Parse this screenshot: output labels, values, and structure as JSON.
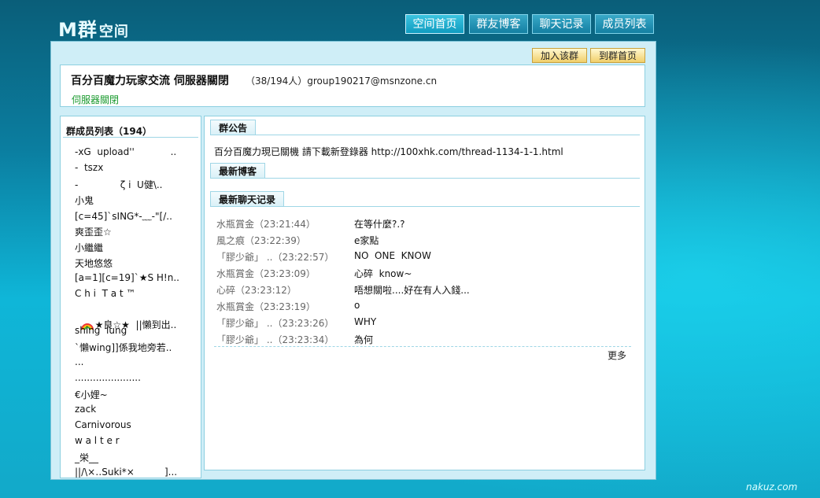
{
  "logo": {
    "main": "M群",
    "sub": "空间"
  },
  "nav": [
    {
      "label": "空间首页"
    },
    {
      "label": "群友博客"
    },
    {
      "label": "聊天记录"
    },
    {
      "label": "成员列表"
    }
  ],
  "actions": {
    "join": "加入该群",
    "home": "到群首页"
  },
  "group": {
    "name": "百分百魔力玩家交流 伺服器關閉",
    "meta": "（38/194人）group190217@msnzone.cn",
    "description": "伺服器關閉"
  },
  "sidebar": {
    "title": "群成员列表（194）",
    "members": [
      "-xG  upload''            ..",
      "-  tszx",
      "-              ζ i  U健\\..",
      "小鬼",
      "[c=45]`sING*-﹏-\"[/..",
      "爽歪歪☆",
      "小繼繼",
      "天地悠悠",
      "[a=1][c=19]`★S H!n..",
      "C h i  T a t ™",
      "★良☆★  ||懶到出..",
      "shing  lung",
      "`懶wing]]係我地旁若..",
      "...",
      "......................",
      "€小娌~",
      "zack",
      "Carnivorous",
      "w a l t e r",
      "_栄__",
      "||/\\×‥Suki*×          ]..."
    ]
  },
  "sections": {
    "announcement": "群公告",
    "blogs": "最新博客",
    "chat": "最新聊天记录"
  },
  "announcement_text": "百分百魔力現已關機 請下載新登錄器 http://100xhk.com/thread-1134-1-1.html",
  "chat": [
    {
      "user": "水瓶賞金（23:21:44）",
      "msg": "在等什麼?.?"
    },
    {
      "user": "風之痕（23:22:39）",
      "msg": "e家點"
    },
    {
      "user": "「膠少爺」 ..（23:22:57）",
      "msg": "NO  ONE  KNOW"
    },
    {
      "user": "水瓶賞金（23:23:09）",
      "msg": "心碎  know~"
    },
    {
      "user": "心碎（23:23:12）",
      "msg": "唔想關啦....好在有人入錢..."
    },
    {
      "user": "水瓶賞金（23:23:19）",
      "msg": "o"
    },
    {
      "user": "「膠少爺」 ..（23:23:26）",
      "msg": "WHY"
    },
    {
      "user": "「膠少爺」 ..（23:23:34）",
      "msg": "為何"
    }
  ],
  "more_label": "更多",
  "watermark": "nakuz.com",
  "colors": {
    "accent": "#0b7ea0",
    "green_text": "#1a9a2e",
    "button_gold": "#f1cf6a"
  }
}
